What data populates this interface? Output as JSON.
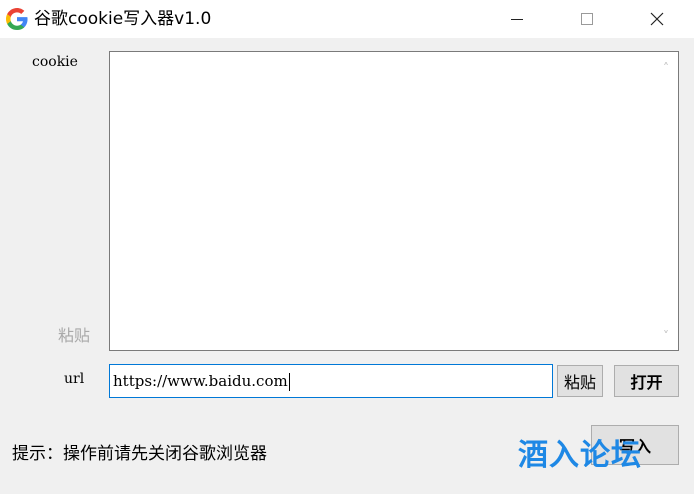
{
  "window": {
    "title": "谷歌cookie写入器v1.0",
    "controls": {
      "minimize": "minimize",
      "maximize": "maximize",
      "close": "close"
    }
  },
  "form": {
    "cookie_label": "cookie",
    "cookie_value": "",
    "paste_hint": "粘贴",
    "url_label": "url",
    "url_value": "https://www.baidu.com",
    "paste_button": "粘贴",
    "open_button": "打开",
    "write_button": "写入"
  },
  "footer": {
    "hint": "提示：操作前请先关闭谷歌浏览器"
  },
  "watermark": "酒入论坛",
  "colors": {
    "accent": "#0078d7",
    "watermark": "#1e88e5"
  }
}
